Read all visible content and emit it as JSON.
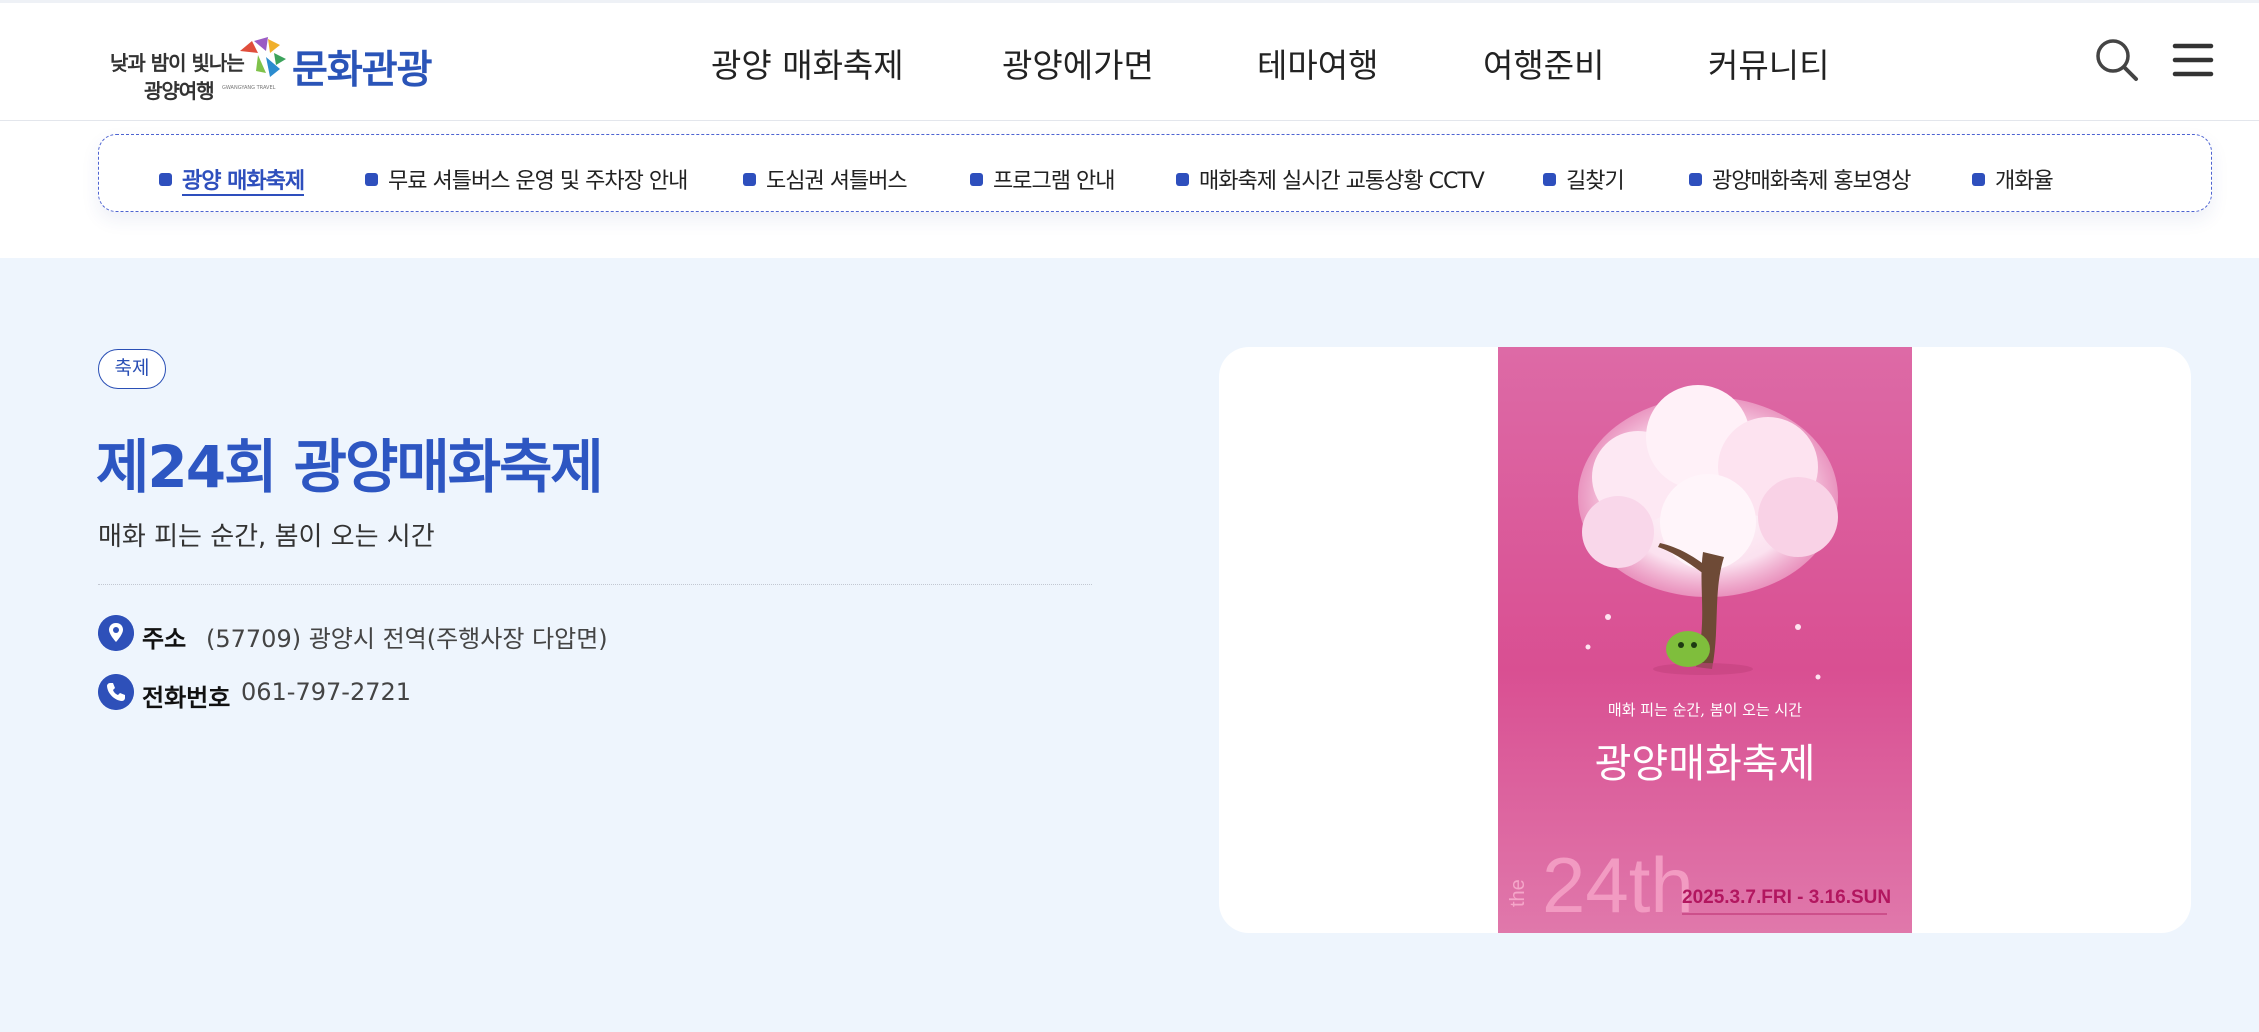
{
  "header": {
    "logo_slogan": "낮과 밤이 빛나는",
    "logo_sub": "광양여행",
    "logo_en": "GWANGYANG TRAVEL",
    "logo_title": "문화관광",
    "nav": [
      "광양 매화축제",
      "광양에가면",
      "테마여행",
      "여행준비",
      "커뮤니티"
    ],
    "search_icon": "search-icon",
    "menu_icon": "hamburger-menu-icon"
  },
  "subnav": {
    "items": [
      "광양 매화축제",
      "무료 셔틀버스 운영 및 주차장 안내",
      "도심권 셔틀버스",
      "프로그램 안내",
      "매화축제 실시간 교통상황 CCTV",
      "길찾기",
      "광양매화축제 홍보영상",
      "개화율"
    ],
    "active_index": 0
  },
  "festival": {
    "badge": "축제",
    "title": "제24회 광양매화축제",
    "subtitle": "매화 피는 순간, 봄이 오는 시간",
    "address_label": "주소",
    "address_value": "(57709) 광양시 전역(주행사장 다압면)",
    "phone_label": "전화번호",
    "phone_value": "061-797-2721"
  },
  "poster": {
    "tagline": "매화 피는 순간, 봄이 오는 시간",
    "title": "광양매화축제",
    "edition_prefix": "the",
    "edition": "24th",
    "dates": "2025.3.7.FRI - 3.16.SUN"
  },
  "colors": {
    "brand_blue": "#2d56c2",
    "bg_light_blue": "#eef5fd",
    "poster_pink": "#dc5a9a"
  }
}
